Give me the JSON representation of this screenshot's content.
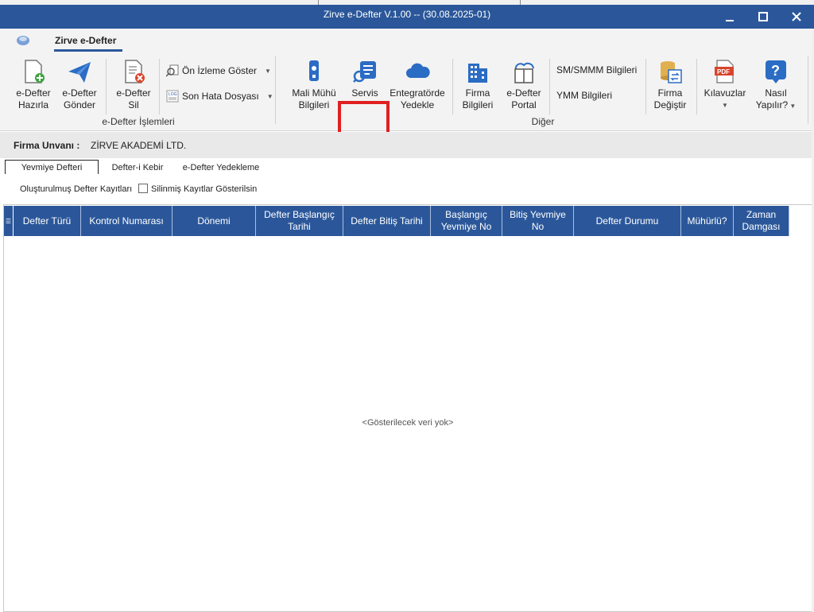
{
  "window": {
    "title": "Zirve e-Defter V.1.00  -- (30.08.2025-01)",
    "minimize_icon": "minimize-icon",
    "maximize_icon": "maximize-icon",
    "close_icon": "close-icon",
    "colors": {
      "titlebar": "#2b579a",
      "highlight": "#e02020"
    }
  },
  "ribbon": {
    "tab": "Zirve e-Defter",
    "buttons": {
      "hazirla": "e-Defter\nHazırla",
      "gonder": "e-Defter\nGönder",
      "sil": "e-Defter\nSil",
      "on_izleme": "Ön İzleme Göster",
      "son_hata": "Son Hata Dosyası",
      "mali_muhur": "Mali Mühü\nBilgileri",
      "servis": "Servis",
      "entegrator": "Entegratörde\nYedekle",
      "firma_bilgileri": "Firma\nBilgileri",
      "portal": "e-Defter\nPortal",
      "smmm": "SM/SMMM Bilgileri",
      "ymm": "YMM Bilgileri",
      "firma_degistir": "Firma\nDeğiştir",
      "kilavuzlar": "Kılavuzlar",
      "nasil": "Nasıl\nYapılır?"
    },
    "groups": {
      "islemler": "e-Defter İşlemleri",
      "diger": "Diğer"
    },
    "pdf_text": "PDF",
    "log_text": "LOG",
    "help_glyph": "?"
  },
  "firma": {
    "label": "Firma Unvanı :",
    "value": "ZİRVE AKADEMİ LTD."
  },
  "tabs": [
    "Yevmiye Defteri",
    "Defter-i Kebir",
    "e-Defter Yedekleme"
  ],
  "subbar": {
    "label": "Oluşturulmuş Defter Kayıtları",
    "checkbox_label": "Silinmiş Kayıtlar Gösterilsin"
  },
  "grid": {
    "columns": [
      "Defter Türü",
      "Kontrol Numarası",
      "Dönemi",
      "Defter Başlangıç\nTarihi",
      "Defter Bitiş Tarihi",
      "Başlangıç\nYevmiye No",
      "Bitiş Yevmiye\nNo",
      "Defter Durumu",
      "Mühürlü?",
      "Zaman\nDamgası"
    ],
    "empty_text": "<Gösterilecek veri yok>"
  }
}
